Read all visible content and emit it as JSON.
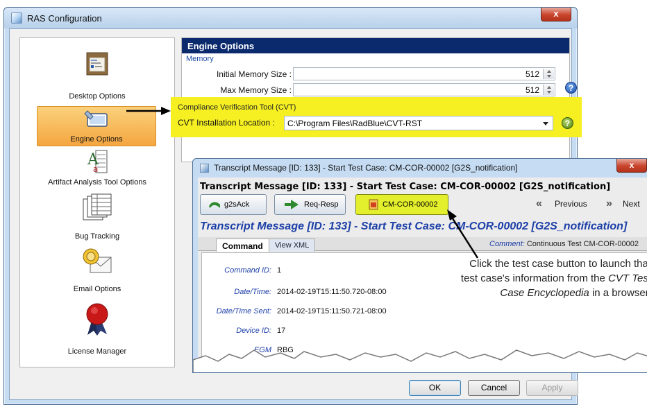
{
  "window": {
    "title": "RAS Configuration",
    "close_glyph": "x"
  },
  "sidebar": {
    "items": [
      {
        "label": "Desktop Options",
        "icon": "desktop-options-icon"
      },
      {
        "label": "Engine Options",
        "icon": "engine-options-icon",
        "selected": true
      },
      {
        "label": "Artifact Analysis Tool Options",
        "icon": "artifact-analysis-icon"
      },
      {
        "label": "Bug Tracking",
        "icon": "bug-tracking-icon"
      },
      {
        "label": "Email Options",
        "icon": "email-options-icon"
      },
      {
        "label": "License Manager",
        "icon": "license-manager-icon"
      }
    ]
  },
  "engine": {
    "header": "Engine Options",
    "memory_section": "Memory",
    "initial_memory_label": "Initial Memory Size :",
    "initial_memory_value": "512",
    "max_memory_label": "Max Memory Size :",
    "max_memory_value": "512",
    "help_glyph": "?",
    "cvt_section": "Compliance Verification Tool (CVT)",
    "cvt_location_label": "CVT Installation Location :",
    "cvt_location_value": "C:\\Program Files\\RadBlue\\CVT-RST"
  },
  "buttons": {
    "ok": "OK",
    "cancel": "Cancel",
    "apply": "Apply"
  },
  "transcript": {
    "window_title": "Transcript Message [ID: 133] - Start Test Case: CM-COR-00002 [G2S_notification]",
    "close_glyph": "x",
    "heading": "Transcript Message [ID: 133] - Start Test Case: CM-COR-00002 [G2S_notification]",
    "toolbar": {
      "ack_label": "g2sAck",
      "reqresp_label": "Req-Resp",
      "testcase_label": "CM-COR-00002",
      "previous_label": "Previous",
      "next_label": "Next"
    },
    "big_title": "Transcript Message [ID: 133] - Start Test Case: CM-COR-00002 [G2S_notification]",
    "tabs": [
      "Command",
      "View XML"
    ],
    "comment_label": "Comment:",
    "comment_value": "Continuous Test CM-COR-00002",
    "fields": [
      {
        "label": "Command ID:",
        "value": "1"
      },
      {
        "label": "Date/Time:",
        "value": "2014-02-19T15:11:50.720-08:00"
      },
      {
        "label": "Date/Time Sent:",
        "value": "2014-02-19T15:11:50.721-08:00"
      },
      {
        "label": "Device ID:",
        "value": "17"
      },
      {
        "label": "EGM",
        "value": "RBG"
      }
    ]
  },
  "callout": {
    "line1": "Click the test case button to launch that",
    "line2_pre": "test case's information from the ",
    "line2_em": "CVT Test",
    "line3_em": "Case Encyclopedia",
    "line3_post": " in a browser."
  }
}
